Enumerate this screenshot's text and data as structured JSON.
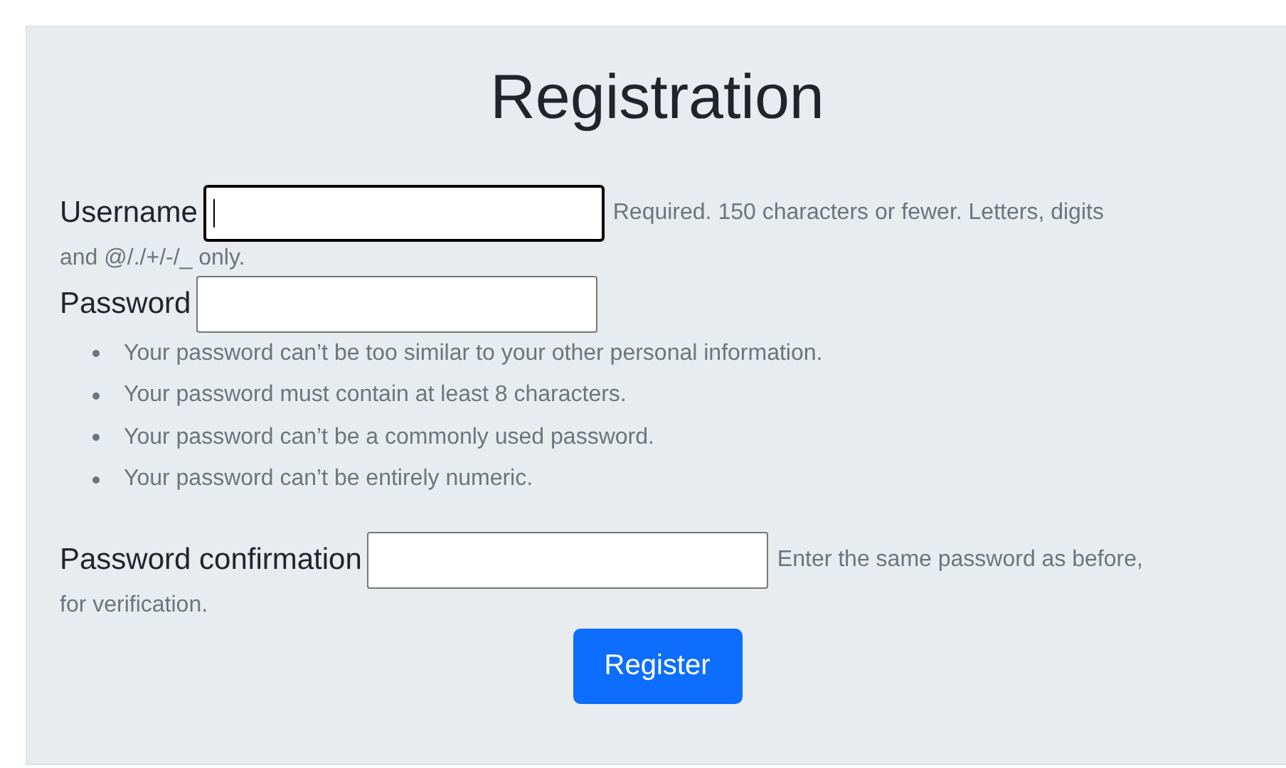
{
  "title": "Registration",
  "fields": [
    {
      "label": "Username",
      "focused": true,
      "help": [
        "Required. 150 characters or fewer. Letters, digits",
        "and @/./+/-/_ only."
      ]
    },
    {
      "label": "Password",
      "focused": false,
      "rules": [
        "Your password can’t be too similar to your other personal information.",
        "Your password must contain at least 8 characters.",
        "Your password can’t be a commonly used password.",
        "Your password can’t be entirely numeric."
      ]
    },
    {
      "label": "Password confirmation",
      "focused": false,
      "help": [
        "Enter the same password as before,",
        "for verification."
      ]
    }
  ],
  "submit": "Register"
}
